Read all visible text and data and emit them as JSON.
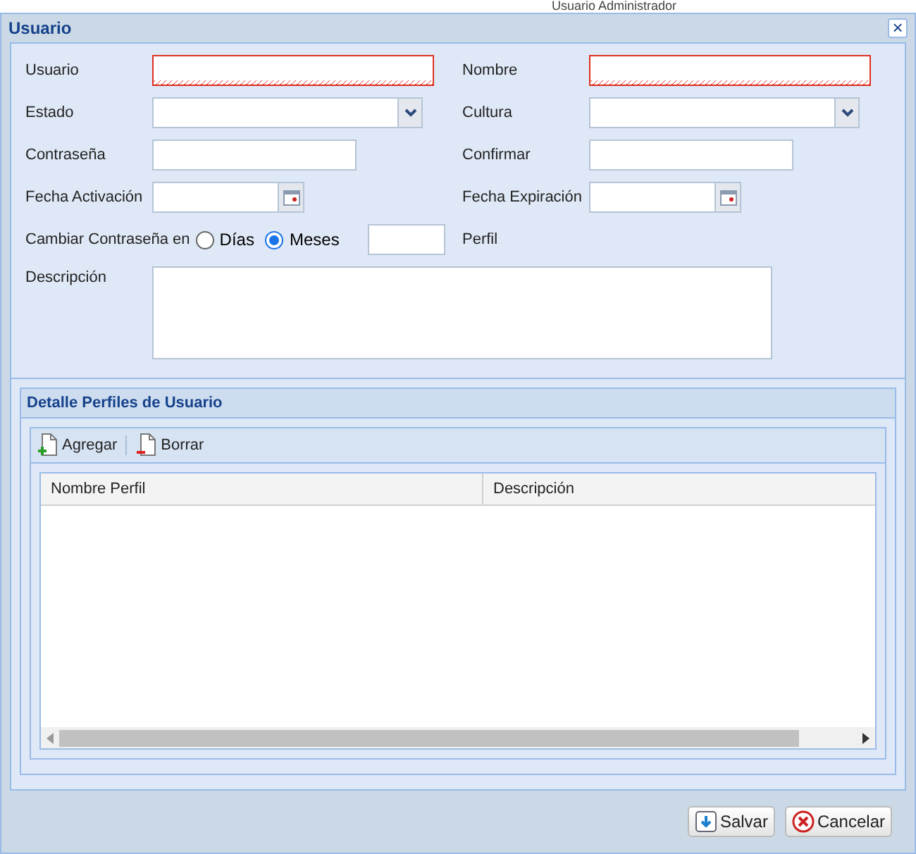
{
  "background_text": "Usuario Administrador",
  "window": {
    "title": "Usuario",
    "close": "×"
  },
  "form_rows": [
    {
      "left": {
        "label": "Usuario",
        "kind": "text",
        "invalid": true
      },
      "right": {
        "label": "Nombre",
        "kind": "text",
        "invalid": true
      }
    },
    {
      "left": {
        "label": "Estado",
        "kind": "combo",
        "invalid": false
      },
      "right": {
        "label": "Cultura",
        "kind": "combo",
        "invalid": false
      }
    },
    {
      "left": {
        "label": "Contraseña",
        "kind": "password",
        "invalid": false
      },
      "right": {
        "label": "Confirmar",
        "kind": "password",
        "invalid": false
      }
    },
    {
      "left": {
        "label": "Fecha Activación",
        "kind": "date",
        "invalid": false
      },
      "right": {
        "label": "Fecha Expiración",
        "kind": "date",
        "invalid": false
      }
    },
    {
      "left": {
        "label": "Cambiar Contraseña en",
        "kind": "radio",
        "options": [
          {
            "label": "Días",
            "selected": false
          },
          {
            "label": "Meses",
            "selected": true
          }
        ]
      },
      "right": {
        "label": "Perfil",
        "kind": "none"
      }
    }
  ],
  "description": {
    "label": "Descripción"
  },
  "panel": {
    "title": "Detalle Perfiles de Usuario",
    "toolbar": [
      {
        "label": "Agregar",
        "kind": "add"
      },
      {
        "label": "Borrar",
        "kind": "remove"
      }
    ],
    "table": {
      "columns": [
        "Nombre Perfil",
        "Descripción"
      ]
    }
  },
  "buttons": [
    {
      "label": "Salvar",
      "kind": "save"
    },
    {
      "label": "Cancelar",
      "kind": "cancel"
    }
  ]
}
